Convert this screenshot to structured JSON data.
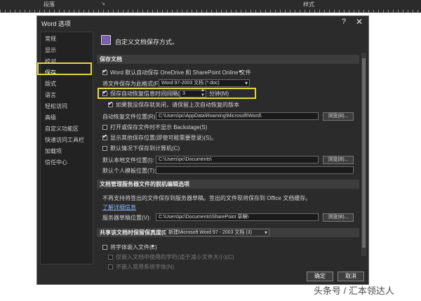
{
  "ribbon": {
    "left_label": "段落",
    "right_label": "样式"
  },
  "dialog": {
    "title": "Word 选项",
    "help_icon": "question-icon",
    "close_icon": "close-icon"
  },
  "sidebar": {
    "items": [
      {
        "label": "常规"
      },
      {
        "label": "显示"
      },
      {
        "label": "校对"
      },
      {
        "label": "保存"
      },
      {
        "label": "版式"
      },
      {
        "label": "语言"
      },
      {
        "label": "轻松访问"
      },
      {
        "label": "高级"
      },
      {
        "label": "自定义功能区"
      },
      {
        "label": "快速访问工具栏"
      },
      {
        "label": "加载项"
      },
      {
        "label": "信任中心"
      }
    ],
    "selected": "保存"
  },
  "main": {
    "heading": "自定义文档保存方式。",
    "sec1": {
      "title": "保存文档",
      "autosave_label": "Word 默认自动保存 OneDrive 和 SharePoint Online 文件",
      "format_label": "将文件保存为此格式(F):",
      "format_value": "Word 97-2003 文档 (*.doc)",
      "autorecover_label": "保存自动恢复信息时间间隔(A)",
      "autorecover_value": "3",
      "minutes_label": "分钟(M)",
      "keep_last_label": "如果我没保存就关闭，请保留上次自动恢复的版本",
      "recover_loc_label": "自动恢复文件位置(R):",
      "recover_loc_value": "C:\\Users\\pc\\AppData\\Roaming\\Microsoft\\Word\\",
      "browse1": "浏览(B)...",
      "backstage_label": "打开或保存文件时不显示 Backstage(S)",
      "show_more_label": "显示其他保存位置(即使可能需要登录)(S)。",
      "default_pc_label": "默认情况下保存到计算机(C)",
      "local_loc_label": "默认本地文件位置(I):",
      "local_loc_value": "C:\\Users\\pc\\Documents\\",
      "browse2": "浏览(B)...",
      "template_label": "默认个人模板位置(T):",
      "template_value": ""
    },
    "sec2": {
      "title": "文档管理服务器文件的脱机编辑选项",
      "desc": "不再支持将签出的文件保存到服务器草稿。签出的文件现将保存到 Office 文档缓存。",
      "link": "了解详细信息",
      "drafts_label": "服务器草稿位置(V):",
      "drafts_value": "C:\\Users\\pc\\Documents\\SharePoint 草稿\\",
      "browse3": "浏览(B)..."
    },
    "sec3": {
      "title_label": "共享该文档时保留保真度(D):",
      "doc_value": "新建Microsoft Word 97 - 2003 文档 (3)",
      "embed_label": "将字体嵌入文件(E)",
      "embed_only_label": "仅嵌入文档中使用的字符(适于减小文件大小)(C)",
      "no_common_label": "不嵌入常用系统字体(N)"
    }
  },
  "footer": {
    "ok": "确定",
    "cancel": "取消"
  },
  "watermark": "头条号 / 汇本领达人",
  "colors": {
    "dialog_bg": "#2b2b2b",
    "highlight": "#e8d840",
    "section_header": "#3d3d3d"
  }
}
